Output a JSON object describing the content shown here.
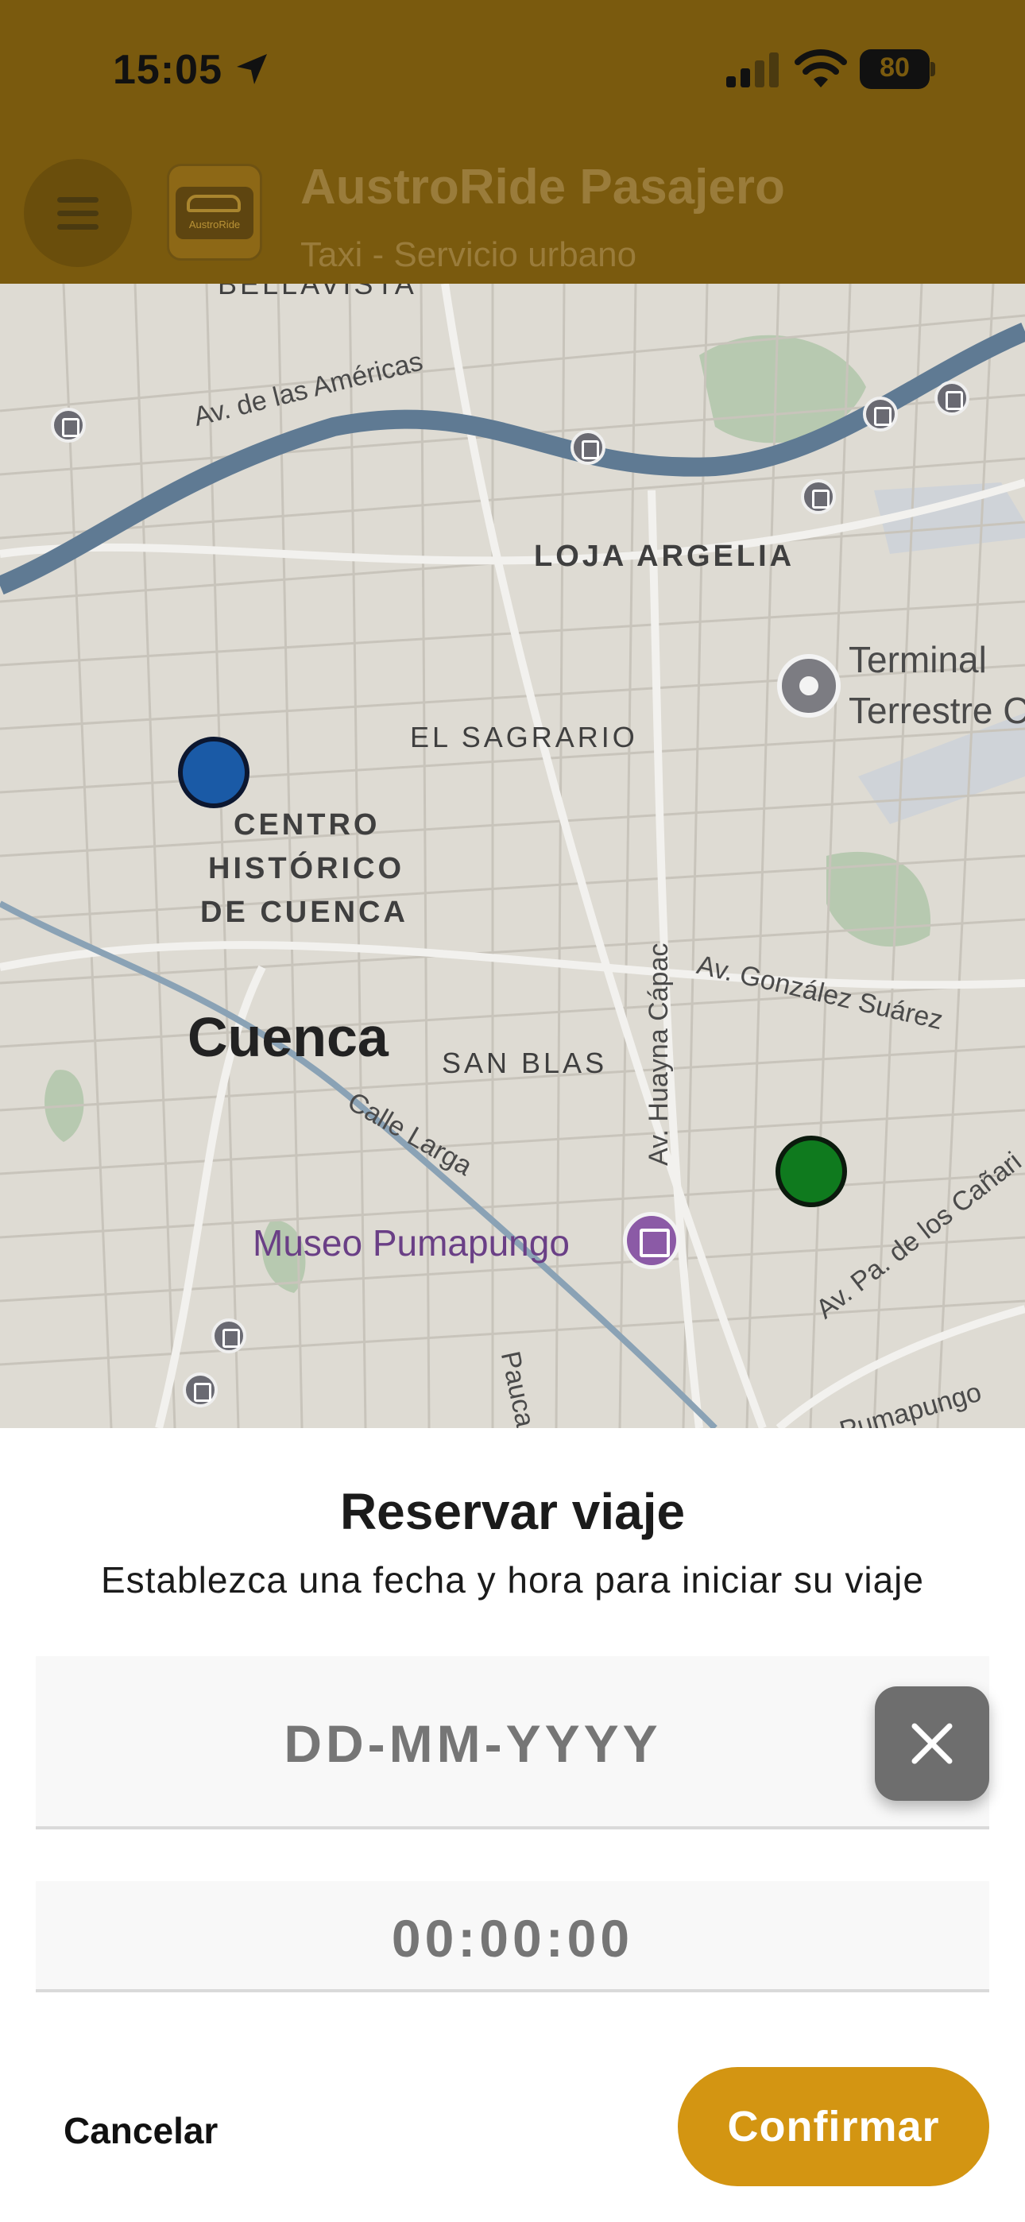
{
  "status_bar": {
    "time": "15:05",
    "battery": "80"
  },
  "header": {
    "title": "AustroRide Pasajero",
    "subtitle": "Taxi - Servicio urbano",
    "logo_text": "AustroRide"
  },
  "map": {
    "labels": {
      "bellavista": "BELLAVISTA",
      "av_americas": "Av. de las Américas",
      "loja_argelia": "LOJA ARGELIA",
      "terminal_line1": "Terminal",
      "terminal_line2": "Terrestre C",
      "el_sagrario": "EL SAGRARIO",
      "centro_1": "CENTRO",
      "centro_2": "HISTÓRICO",
      "centro_3": "DE CUENCA",
      "cuenca": "Cuenca",
      "san_blas": "SAN BLAS",
      "huayna_capac": "Av. Huayna Cápac",
      "gonzalez_suarez": "Av. González Suárez",
      "calle_larga": "Calle Larga",
      "museo": "Museo Pumapungo",
      "canaris": "Av. Pa. de los Cañari",
      "pumapungo": "Av. Pumapungo",
      "pauca": "Pauca"
    },
    "colors": {
      "origin_pin": "#1a5aa6",
      "destination_pin": "#0f7a1e"
    }
  },
  "sheet": {
    "title": "Reservar viaje",
    "subtitle": "Establezca una fecha y hora para iniciar su viaje",
    "date_placeholder": "DD-MM-YYYY",
    "time_placeholder": "00:00:00",
    "cancel_label": "Cancelar",
    "confirm_label": "Confirmar",
    "accent_color": "#d39512"
  }
}
